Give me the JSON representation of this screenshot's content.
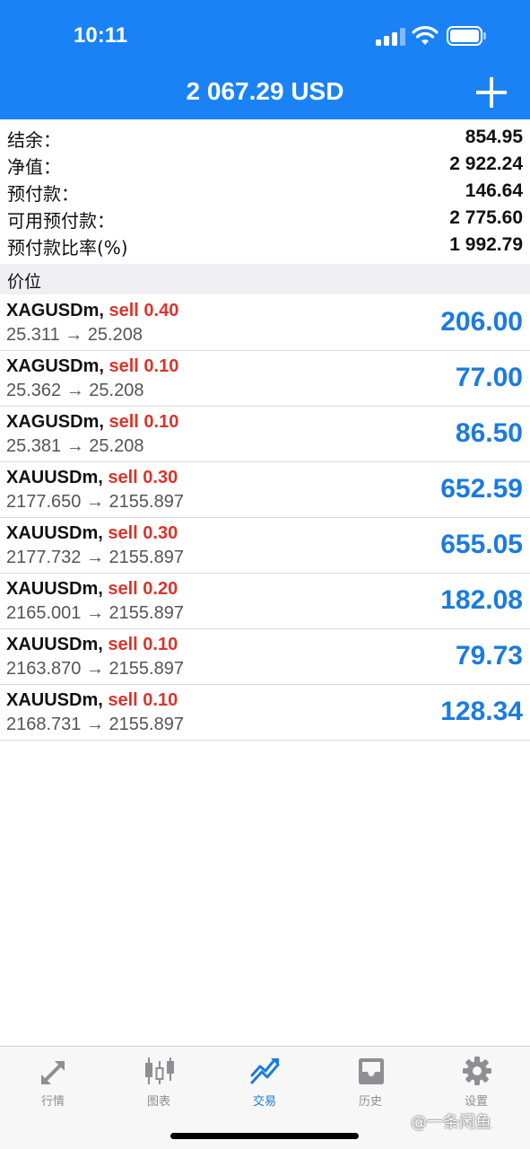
{
  "status_bar": {
    "time": "10:11"
  },
  "header": {
    "title": "2 067.29 USD"
  },
  "summary": [
    {
      "label": "结余：",
      "value": "854.95"
    },
    {
      "label": "净值：",
      "value": "2 922.24"
    },
    {
      "label": "预付款：",
      "value": "146.64"
    },
    {
      "label": "可用预付款：",
      "value": "2 775.60"
    },
    {
      "label": "预付款比率(%)",
      "value": "1 992.79"
    }
  ],
  "section_title": "价位",
  "positions": [
    {
      "symbol": "XAGUSDm,",
      "side": "sell 0.40",
      "prices": "25.311 → 25.208",
      "profit": "206.00"
    },
    {
      "symbol": "XAGUSDm,",
      "side": "sell 0.10",
      "prices": "25.362 → 25.208",
      "profit": "77.00"
    },
    {
      "symbol": "XAGUSDm,",
      "side": "sell 0.10",
      "prices": "25.381 → 25.208",
      "profit": "86.50"
    },
    {
      "symbol": "XAUUSDm,",
      "side": "sell 0.30",
      "prices": "2177.650 → 2155.897",
      "profit": "652.59"
    },
    {
      "symbol": "XAUUSDm,",
      "side": "sell 0.30",
      "prices": "2177.732 → 2155.897",
      "profit": "655.05"
    },
    {
      "symbol": "XAUUSDm,",
      "side": "sell 0.20",
      "prices": "2165.001 → 2155.897",
      "profit": "182.08"
    },
    {
      "symbol": "XAUUSDm,",
      "side": "sell 0.10",
      "prices": "2163.870 → 2155.897",
      "profit": "79.73"
    },
    {
      "symbol": "XAUUSDm,",
      "side": "sell 0.10",
      "prices": "2168.731 → 2155.897",
      "profit": "128.34"
    }
  ],
  "tabs": [
    {
      "label": "行情",
      "icon": "quotes-arrows-icon",
      "active": false
    },
    {
      "label": "图表",
      "icon": "candlestick-chart-icon",
      "active": false
    },
    {
      "label": "交易",
      "icon": "trade-trend-icon",
      "active": true
    },
    {
      "label": "历史",
      "icon": "history-inbox-icon",
      "active": false
    },
    {
      "label": "设置",
      "icon": "settings-gear-icon",
      "active": false
    }
  ],
  "watermark": "@一条闲鱼",
  "colors": {
    "accent": "#1a82f5",
    "profit": "#1a7be0",
    "sell": "#d9352b"
  }
}
